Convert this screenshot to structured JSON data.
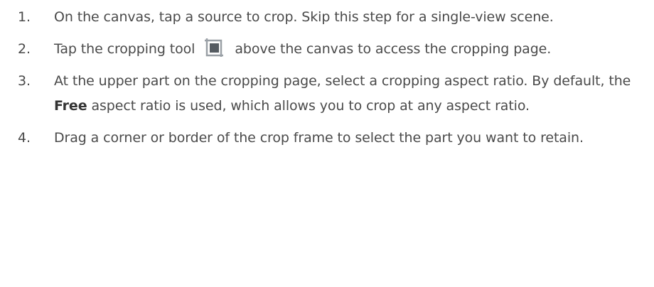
{
  "steps": [
    {
      "number": "1.",
      "text": "On the canvas, tap a source to crop. Skip this step for a single-view scene."
    },
    {
      "number": "2.",
      "text_before": "Tap the cropping tool",
      "icon": "crop-icon",
      "text_after": "above the canvas to access the cropping page."
    },
    {
      "number": "3.",
      "text_a": "At the upper part on the cropping page, select a cropping aspect ratio. By default, the ",
      "bold": "Free",
      "text_b": " aspect ratio is used, which allows you to crop at any aspect ratio."
    },
    {
      "number": "4.",
      "text": "Drag a corner or border of the crop frame to select the part you want to retain."
    }
  ]
}
